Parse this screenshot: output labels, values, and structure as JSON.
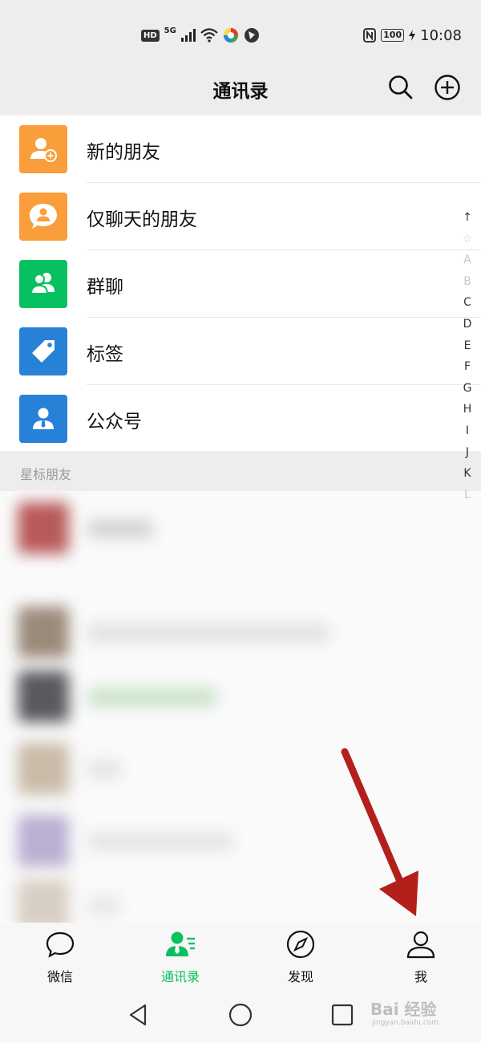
{
  "status_bar": {
    "hd": "HD",
    "network": "5G",
    "battery": "100",
    "time": "10:08"
  },
  "header": {
    "title": "通讯录",
    "search_icon": "search-icon",
    "add_icon": "plus-circle-icon"
  },
  "menu": {
    "items": [
      {
        "label": "新的朋友",
        "icon": "add-friend-icon",
        "color": "#fa9d3b"
      },
      {
        "label": "仅聊天的朋友",
        "icon": "chat-only-friend-icon",
        "color": "#fa9d3b"
      },
      {
        "label": "群聊",
        "icon": "group-chat-icon",
        "color": "#07c160"
      },
      {
        "label": "标签",
        "icon": "tag-icon",
        "color": "#2782d7"
      },
      {
        "label": "公众号",
        "icon": "official-account-icon",
        "color": "#2782d7"
      }
    ]
  },
  "section": {
    "starred_label": "星标朋友"
  },
  "index_bar": {
    "letters": [
      "↑",
      "☆",
      "A",
      "B",
      "C",
      "D",
      "E",
      "F",
      "G",
      "H",
      "I",
      "J",
      "K",
      "L"
    ]
  },
  "tabs": [
    {
      "label": "微信",
      "icon": "chat-bubble-icon",
      "active": false
    },
    {
      "label": "通讯录",
      "icon": "contacts-icon",
      "active": true
    },
    {
      "label": "发现",
      "icon": "compass-icon",
      "active": false
    },
    {
      "label": "我",
      "icon": "person-icon",
      "active": false
    }
  ],
  "colors": {
    "accent_green": "#07c160",
    "orange": "#fa9d3b",
    "blue": "#2782d7",
    "annotation_arrow": "#b3201c"
  },
  "watermark": {
    "main": "Bai 经验",
    "sub": "jingyan.baidu.com"
  }
}
